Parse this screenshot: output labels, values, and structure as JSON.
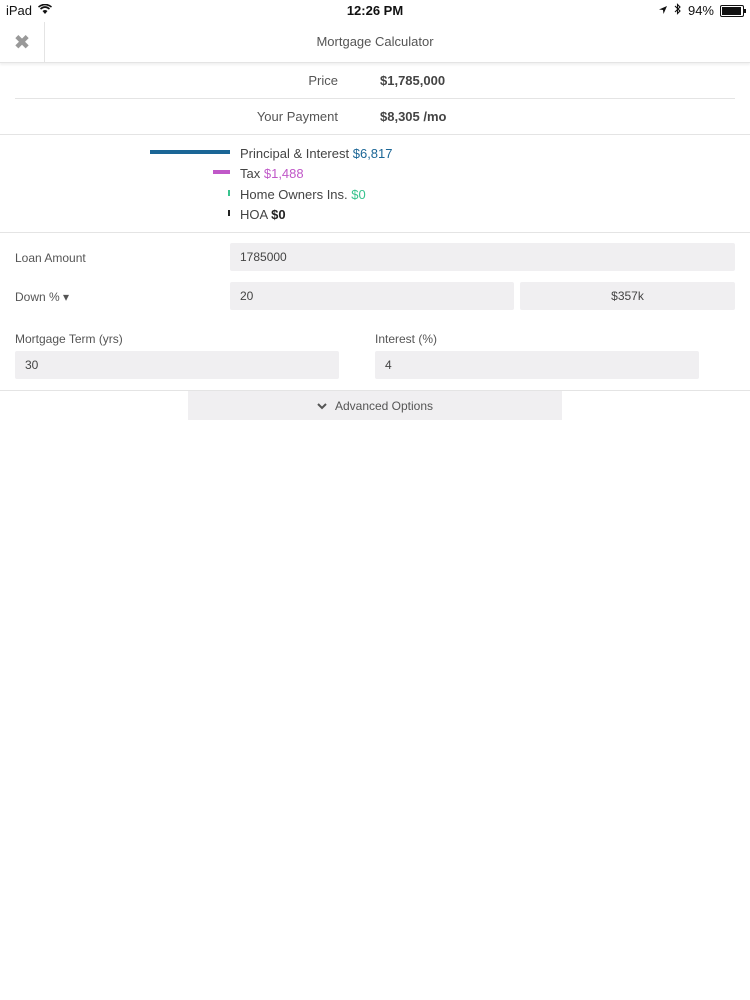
{
  "status_bar": {
    "device": "iPad",
    "time": "12:26 PM",
    "battery": "94%",
    "battery_level": 0.94
  },
  "nav": {
    "title": "Mortgage Calculator",
    "close_icon": "close-icon"
  },
  "summary": {
    "price_label": "Price",
    "price_value": "$1,785,000",
    "payment_label": "Your Payment",
    "payment_value": "$8,305 /mo"
  },
  "breakdown": {
    "items": [
      {
        "label": "Principal & Interest",
        "value": "$6,817",
        "color": "#1b6696",
        "amount": 6817
      },
      {
        "label": "Tax",
        "value": "$1,488",
        "color": "#c058c8",
        "amount": 1488
      },
      {
        "label": "Home Owners Ins.",
        "value": "$0",
        "color": "#38c38e",
        "amount": 0
      },
      {
        "label": "HOA",
        "value": "$0",
        "color": "#222222",
        "amount": 0
      }
    ]
  },
  "form": {
    "loan_amount_label": "Loan Amount",
    "loan_amount_value": "1785000",
    "down_label": "Down % ▾",
    "down_percent_value": "20",
    "down_amount_value": "$357k",
    "term_label": "Mortgage Term (yrs)",
    "term_value": "30",
    "interest_label": "Interest (%)",
    "interest_value": "4"
  },
  "advanced": {
    "label": "Advanced Options"
  }
}
